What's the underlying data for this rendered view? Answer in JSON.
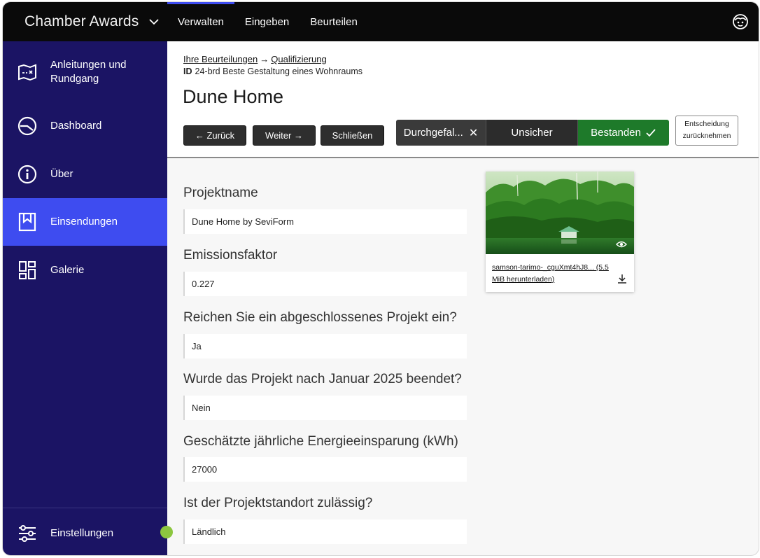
{
  "app": {
    "title": "Chamber Awards"
  },
  "topnav": [
    {
      "label": "Verwalten",
      "active": true
    },
    {
      "label": "Eingeben",
      "active": false
    },
    {
      "label": "Beurteilen",
      "active": false
    }
  ],
  "sidebar": {
    "items": [
      {
        "label": "Anleitungen und Rundgang",
        "icon": "map-icon"
      },
      {
        "label": "Dashboard",
        "icon": "gauge-icon"
      },
      {
        "label": "Über",
        "icon": "info-icon"
      },
      {
        "label": "Einsendungen",
        "icon": "bookmark-icon",
        "active": true
      },
      {
        "label": "Galerie",
        "icon": "grid-icon"
      }
    ],
    "settings_label": "Einstellungen"
  },
  "breadcrumb": {
    "parent": "Ihre Beurteilungen",
    "separator": "→",
    "current": "Qualifizierung"
  },
  "id_line": {
    "prefix": "ID",
    "text": "24-brd Beste Gestaltung eines Wohnraums"
  },
  "page_title": "Dune Home",
  "buttons": {
    "back": "← Zurück",
    "next": "Weiter →",
    "close": "Schließen"
  },
  "decision": {
    "fail": "Durchgefal...",
    "unsure": "Unsicher",
    "pass": "Bestanden",
    "undo_line1": "Entscheidung",
    "undo_line2": "zurücknehmen"
  },
  "fields": [
    {
      "label": "Projektname",
      "value": "Dune Home by SeviForm"
    },
    {
      "label": "Emissionsfaktor",
      "value": "0.227"
    },
    {
      "label": "Reichen Sie ein abgeschlossenes Projekt ein?",
      "value": "Ja"
    },
    {
      "label": "Wurde das Projekt nach Januar 2025 beendet?",
      "value": "Nein"
    },
    {
      "label": "Geschätzte jährliche Energieeinsparung (kWh)",
      "value": "27000"
    },
    {
      "label": "Ist der Projektstandort zulässig?",
      "value": "Ländlich"
    }
  ],
  "attachment": {
    "caption": "samson-tarimo-_cguXmt4hJ8... (5.5 MiB herunterladen)"
  },
  "colors": {
    "sidebar": "#1b1464",
    "accent": "#3e4cf0",
    "pass": "#1e7a2a",
    "topbar": "#0a0a0a"
  }
}
